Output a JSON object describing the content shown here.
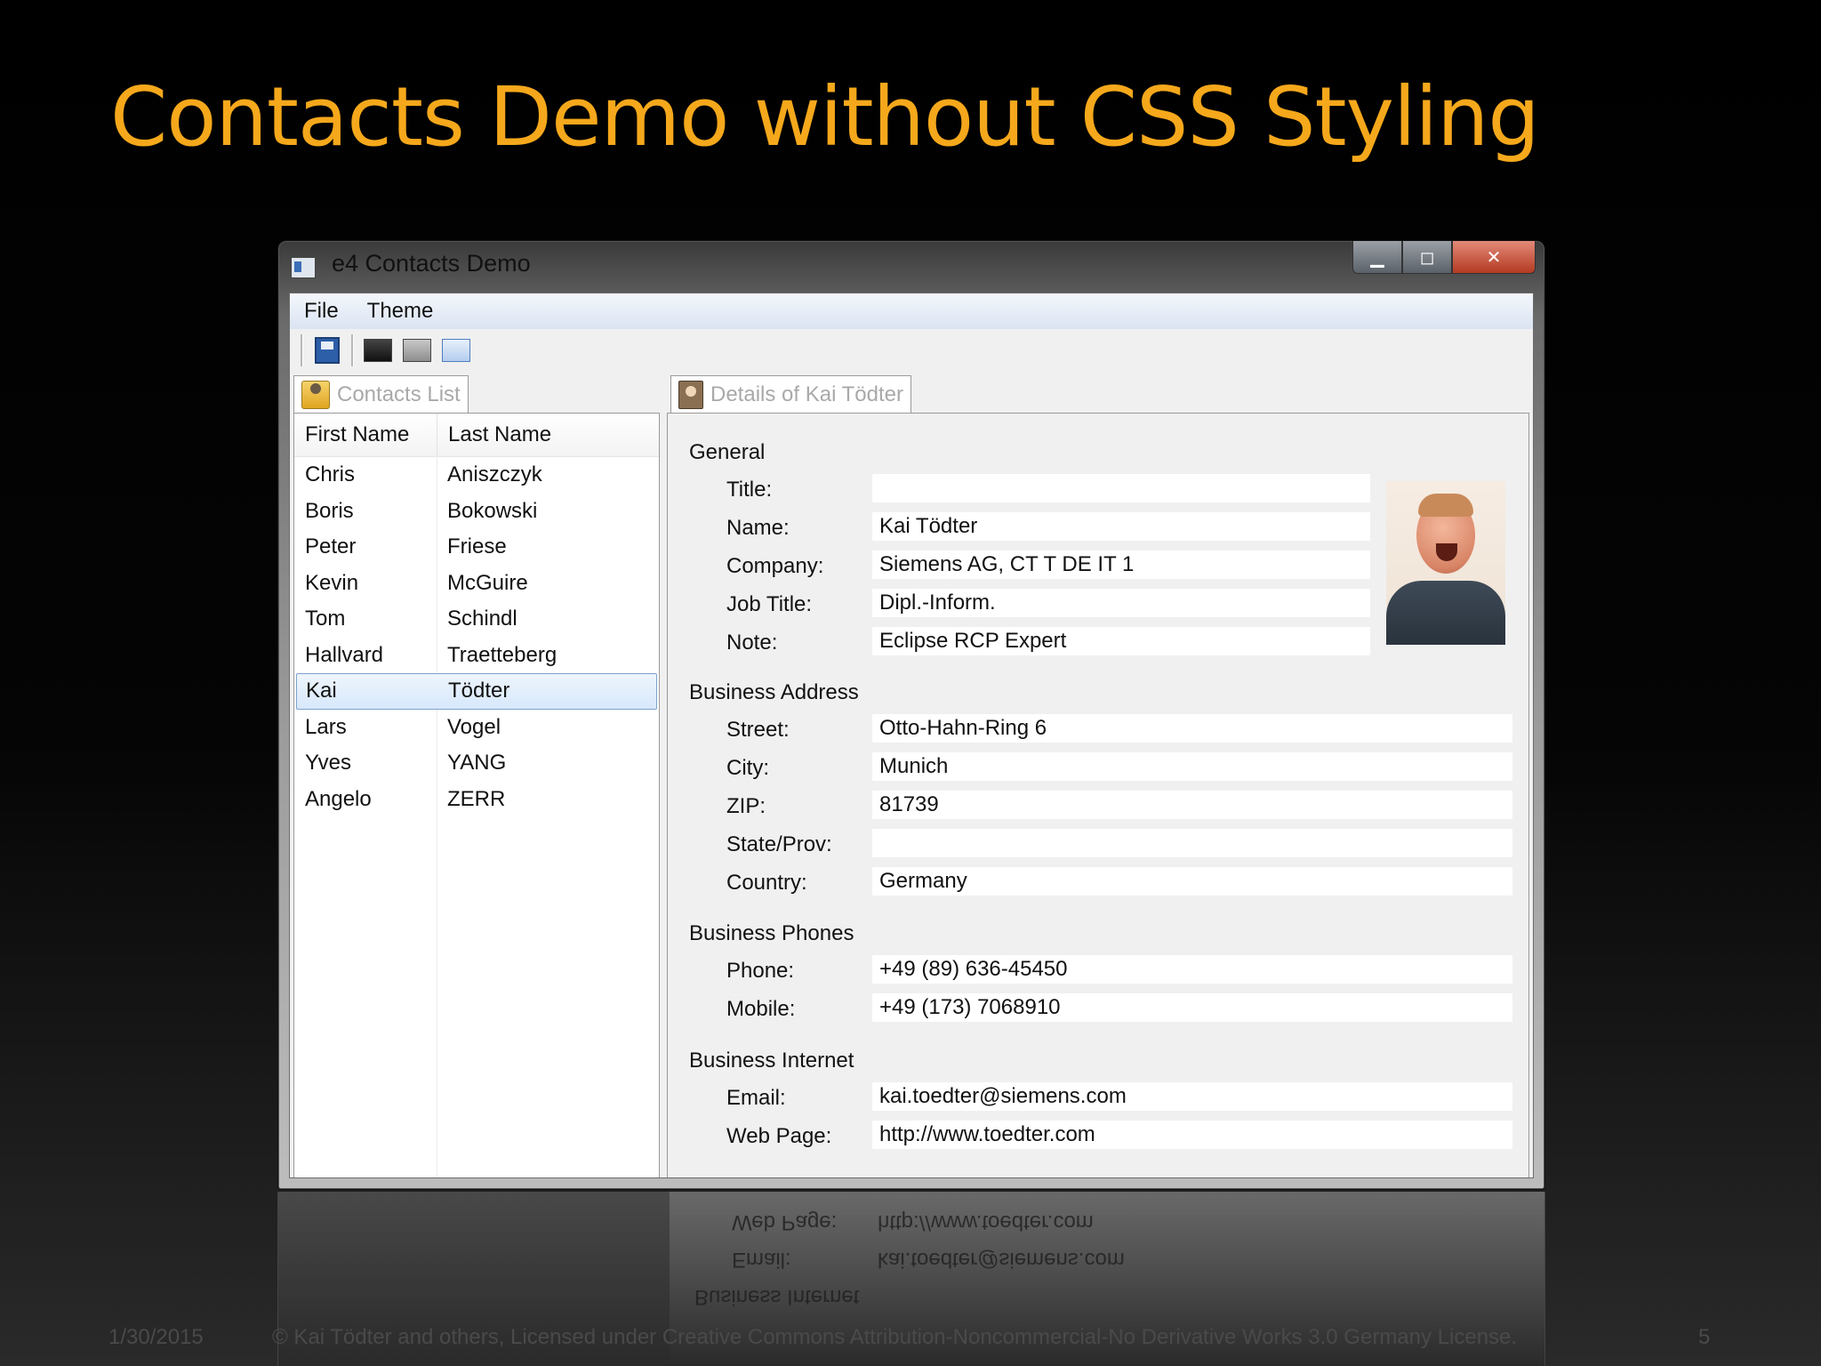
{
  "slide": {
    "title": "Contacts Demo without CSS Styling",
    "date": "1/30/2015",
    "license": "© Kai Tödter and others, Licensed under Creative Commons Attribution-Noncommercial-No Derivative Works 3.0 Germany License.",
    "page_number": "5"
  },
  "window": {
    "title": "e4 Contacts Demo",
    "buttons": {
      "minimize": "▁",
      "maximize": "◻",
      "close": "✕"
    }
  },
  "menu": {
    "items": [
      "File",
      "Theme"
    ]
  },
  "toolbar": {
    "icons": [
      "save-icon",
      "dark-theme-icon",
      "grey-theme-icon",
      "blue-theme-icon"
    ]
  },
  "contacts_list": {
    "tab_label": "Contacts List",
    "columns": [
      "First Name",
      "Last Name"
    ],
    "rows": [
      {
        "first": "Chris",
        "last": "Aniszczyk"
      },
      {
        "first": "Boris",
        "last": "Bokowski"
      },
      {
        "first": "Peter",
        "last": "Friese"
      },
      {
        "first": "Kevin",
        "last": "McGuire"
      },
      {
        "first": "Tom",
        "last": "Schindl"
      },
      {
        "first": "Hallvard",
        "last": "Traetteberg"
      },
      {
        "first": "Kai",
        "last": "Tödter"
      },
      {
        "first": "Lars",
        "last": "Vogel"
      },
      {
        "first": "Yves",
        "last": "YANG"
      },
      {
        "first": "Angelo",
        "last": "ZERR"
      }
    ],
    "selected_index": 6
  },
  "details": {
    "tab_label": "Details of Kai Tödter",
    "groups": [
      {
        "label": "General",
        "fields": [
          {
            "label": "Title:",
            "value": ""
          },
          {
            "label": "Name:",
            "value": "Kai Tödter"
          },
          {
            "label": "Company:",
            "value": "Siemens AG, CT T DE IT 1"
          },
          {
            "label": "Job Title:",
            "value": "Dipl.-Inform."
          },
          {
            "label": "Note:",
            "value": "Eclipse RCP Expert"
          }
        ]
      },
      {
        "label": "Business Address",
        "fields": [
          {
            "label": "Street:",
            "value": "Otto-Hahn-Ring 6"
          },
          {
            "label": "City:",
            "value": "Munich"
          },
          {
            "label": "ZIP:",
            "value": "81739"
          },
          {
            "label": "State/Prov:",
            "value": ""
          },
          {
            "label": "Country:",
            "value": "Germany"
          }
        ]
      },
      {
        "label": "Business Phones",
        "fields": [
          {
            "label": "Phone:",
            "value": "+49 (89) 636-45450"
          },
          {
            "label": "Mobile:",
            "value": "+49 (173) 7068910"
          }
        ]
      },
      {
        "label": "Business Internet",
        "fields": [
          {
            "label": "Email:",
            "value": "kai.toedter@siemens.com"
          },
          {
            "label": "Web Page:",
            "value": "http://www.toedter.com"
          }
        ]
      }
    ]
  },
  "colors": {
    "title": "#f5a81b",
    "selection": "#d7e8fb"
  }
}
